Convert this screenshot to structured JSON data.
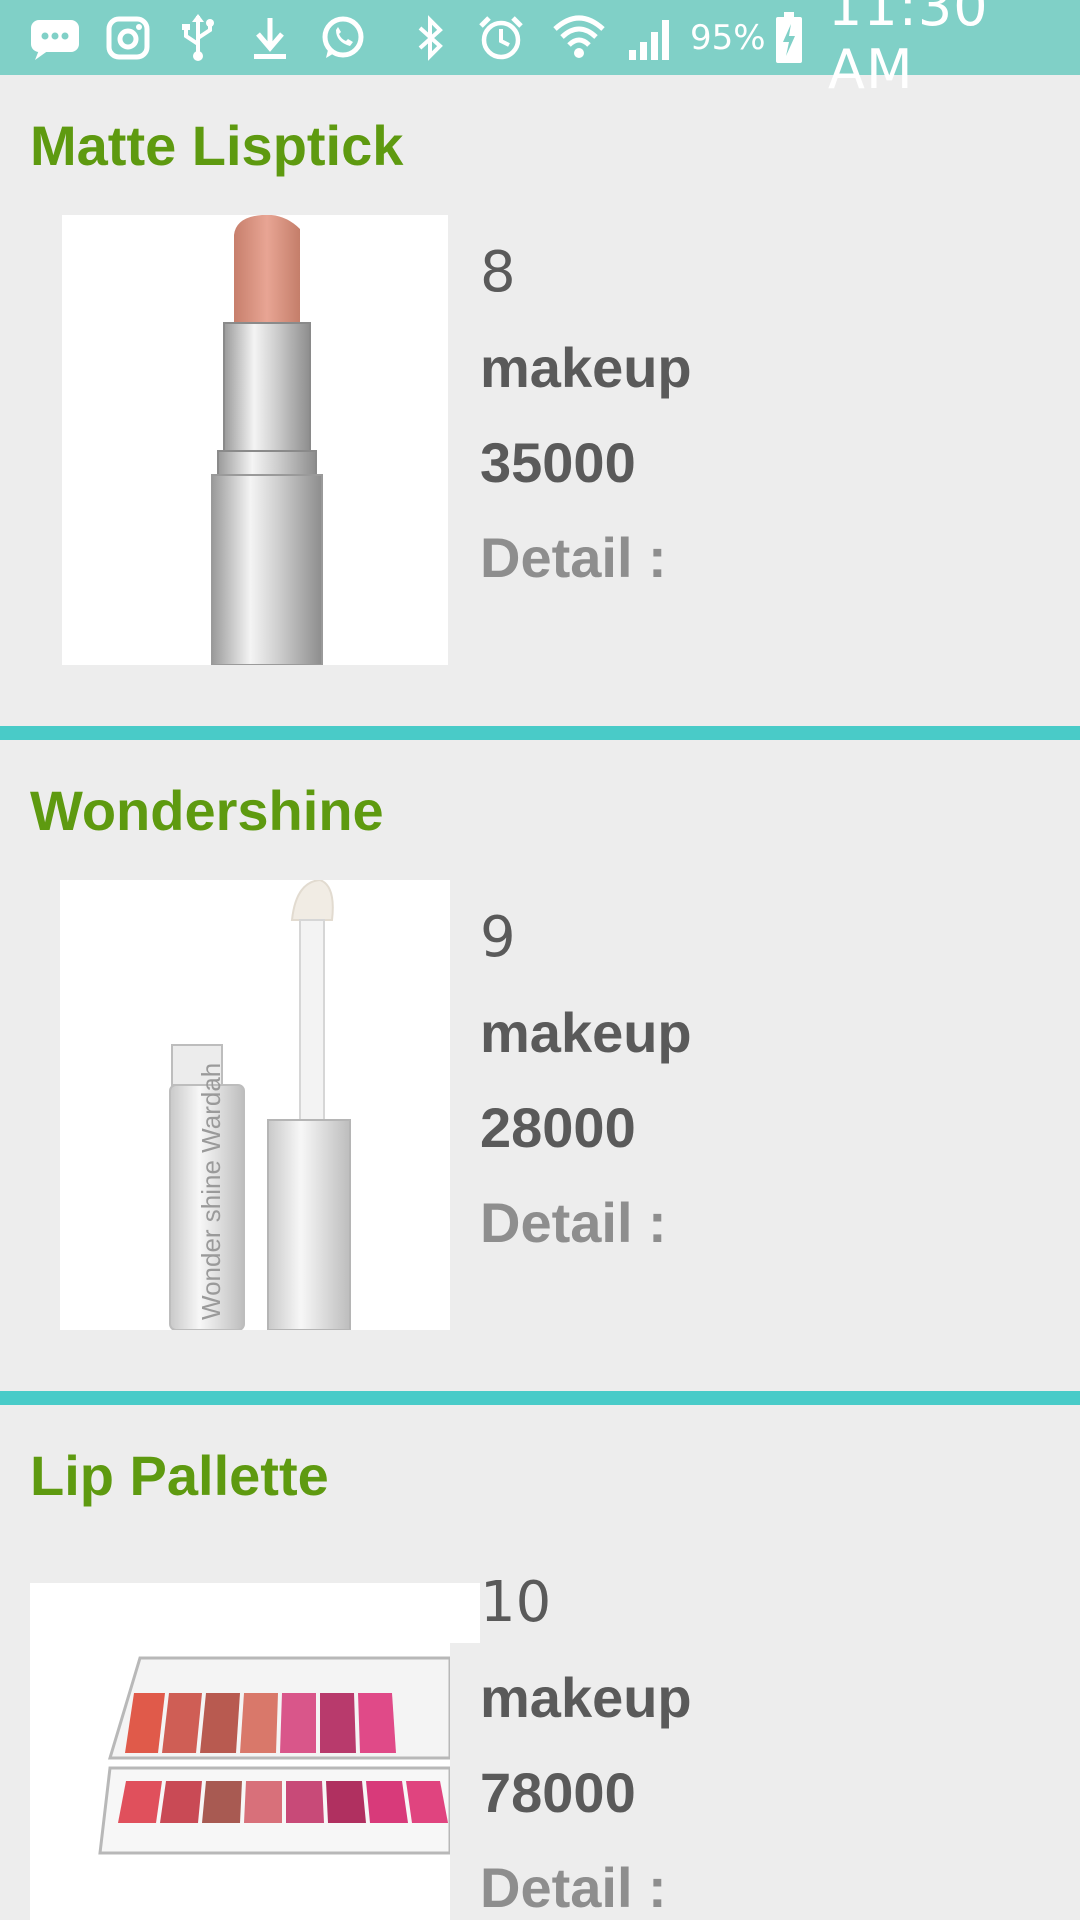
{
  "status_bar": {
    "icons": [
      "chat-bubble-icon",
      "instagram-icon",
      "usb-icon",
      "download-icon",
      "whatsapp-icon",
      "bluetooth-icon",
      "alarm-icon",
      "wifi-icon",
      "cellular-signal-icon",
      "battery-charging-icon"
    ],
    "battery_percent": "95%",
    "time": "11:30 AM",
    "background_color": "#80d0c7"
  },
  "products": [
    {
      "name": "Matte Lisptick",
      "id": "8",
      "category": "makeup",
      "price": "35000",
      "detail_label": "Detail :",
      "image_icon": "lipstick-image"
    },
    {
      "name": "Wondershine",
      "id": "9",
      "category": "makeup",
      "price": "28000",
      "detail_label": "Detail :",
      "image_icon": "lip-gloss-image",
      "image_text": "Wonder shine Wardah"
    },
    {
      "name": "Lip Pallette",
      "id": "10",
      "category": "makeup",
      "price": "78000",
      "detail_label": "Detail :",
      "image_icon": "lip-palette-image"
    }
  ],
  "colors": {
    "title": "#5e9a10",
    "divider": "#49cbc8",
    "background": "#ededed"
  }
}
